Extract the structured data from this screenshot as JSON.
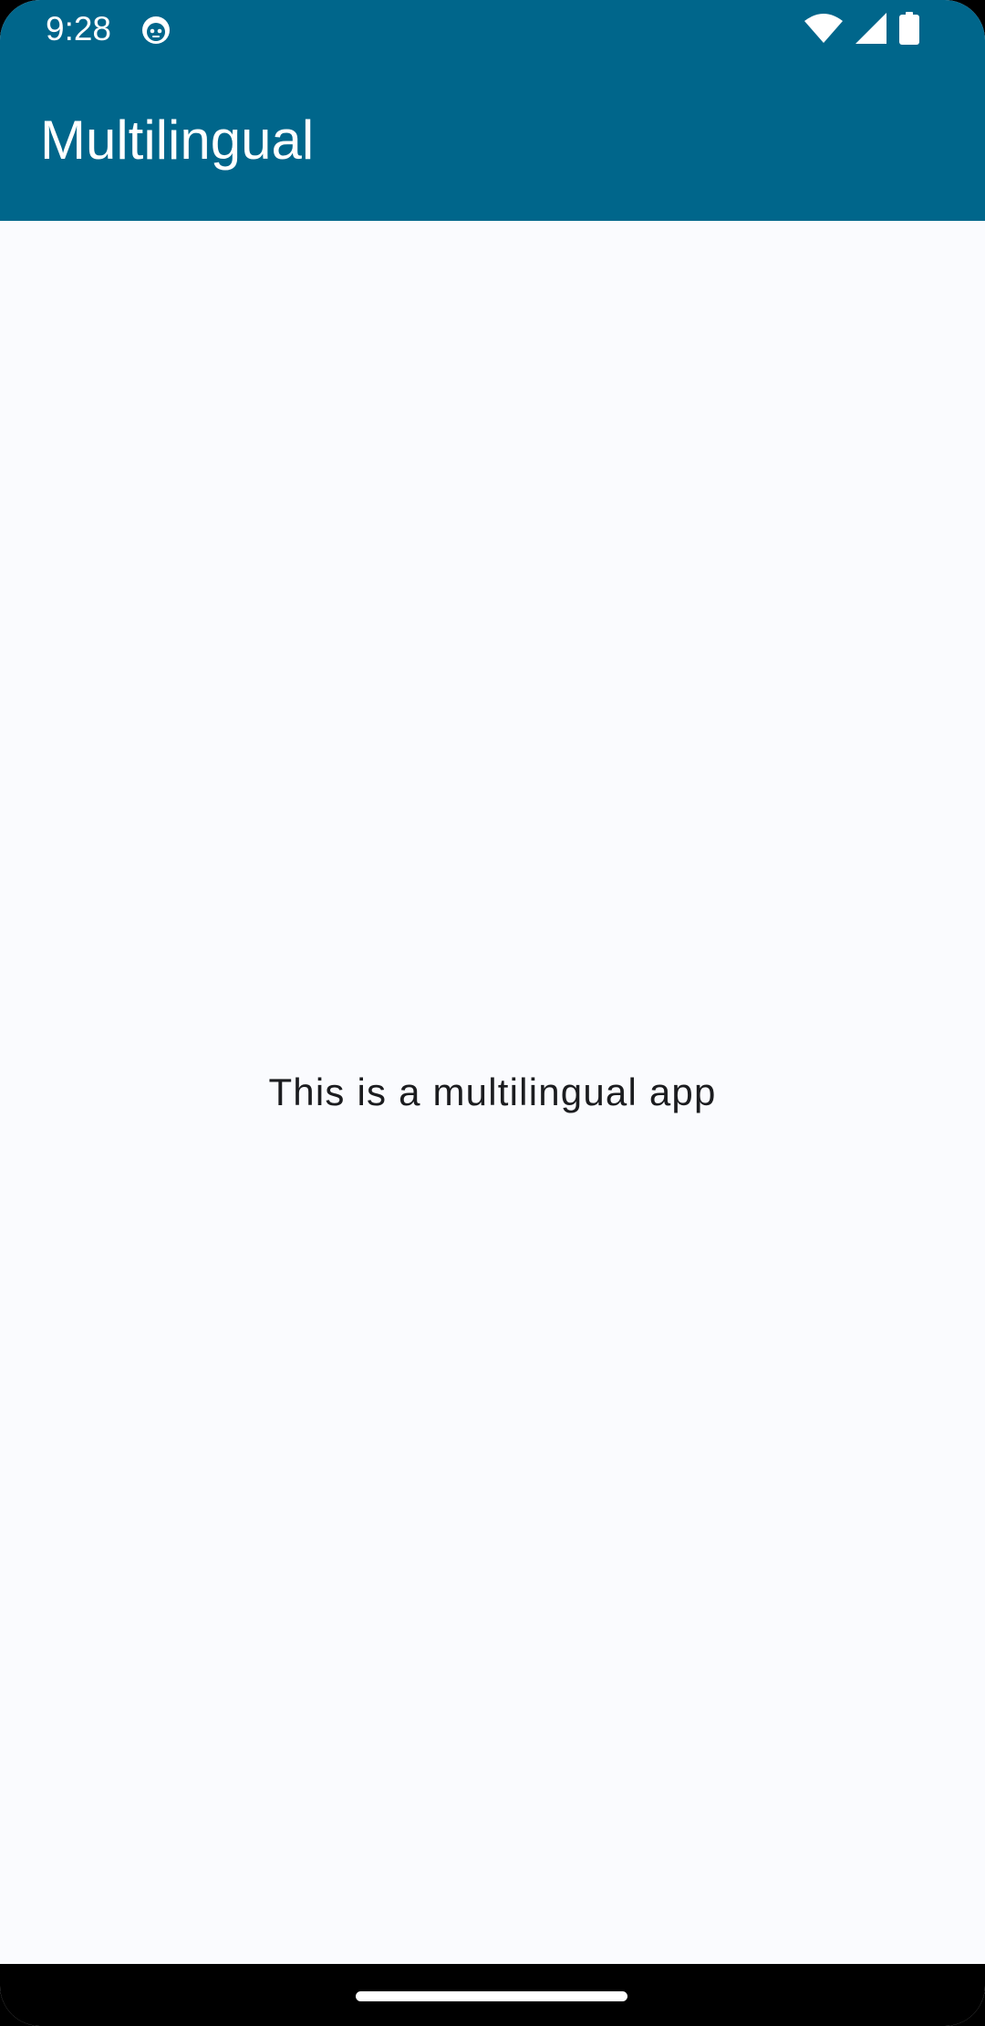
{
  "status_bar": {
    "time": "9:28",
    "icons": [
      "app-notification-icon",
      "wifi-icon",
      "cell-signal-icon",
      "battery-icon"
    ]
  },
  "app_bar": {
    "title": "Multilingual"
  },
  "main": {
    "message": "This is a multilingual app"
  },
  "colors": {
    "primary": "#00668b",
    "background": "#fafbfe",
    "text": "#1b1c1f",
    "on_primary": "#ffffff",
    "nav_bar": "#000000"
  }
}
